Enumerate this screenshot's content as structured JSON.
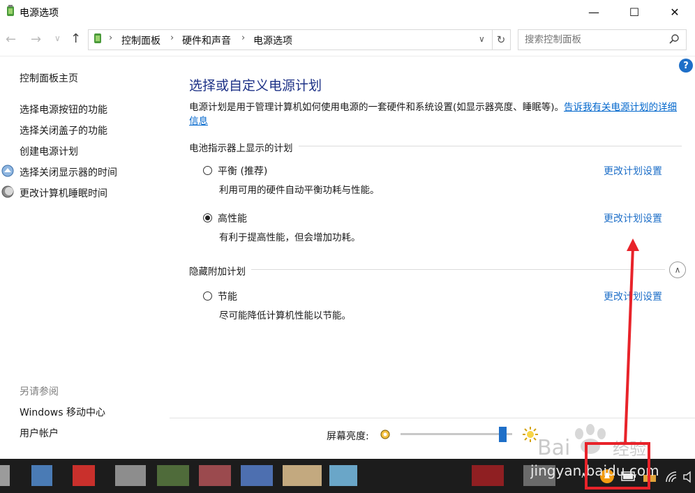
{
  "window": {
    "title": "电源选项",
    "minimize_glyph": "—",
    "maximize_glyph": "☐",
    "close_glyph": "✕"
  },
  "nav": {
    "breadcrumbs": [
      "控制面板",
      "硬件和声音",
      "电源选项"
    ],
    "search_placeholder": "搜索控制面板"
  },
  "sidebar": {
    "home": "控制面板主页",
    "links": [
      "选择电源按钮的功能",
      "选择关闭盖子的功能",
      "创建电源计划",
      "选择关闭显示器的时间",
      "更改计算机睡眠时间"
    ],
    "see_also_title": "另请参阅",
    "see_also": [
      "Windows 移动中心",
      "用户帐户"
    ]
  },
  "main": {
    "title": "选择或自定义电源计划",
    "description": "电源计划是用于管理计算机如何使用电源的一套硬件和系统设置(如显示器亮度、睡眠等)。",
    "description_link": "告诉我有关电源计划的详细信息",
    "battery_section": "电池指示器上显示的计划",
    "hidden_section": "隐藏附加计划",
    "plans": [
      {
        "name": "平衡 (推荐)",
        "desc": "利用可用的硬件自动平衡功耗与性能。",
        "link": "更改计划设置",
        "selected": false
      },
      {
        "name": "高性能",
        "desc": "有利于提高性能，但会增加功耗。",
        "link": "更改计划设置",
        "selected": true
      },
      {
        "name": "节能",
        "desc": "尽可能降低计算机性能以节能。",
        "link": "更改计划设置",
        "selected": false
      }
    ],
    "help_glyph": "?"
  },
  "brightness": {
    "label": "屏幕亮度:",
    "level": 0.95
  },
  "watermark": {
    "brand": "Baidu 经验",
    "url": "jingyan.baidu.com"
  },
  "colors": {
    "accent": "#1e6fc8",
    "title_blue": "#1e3287",
    "annotation_red": "#e8232a",
    "taskbar": "#1c1c1c"
  }
}
